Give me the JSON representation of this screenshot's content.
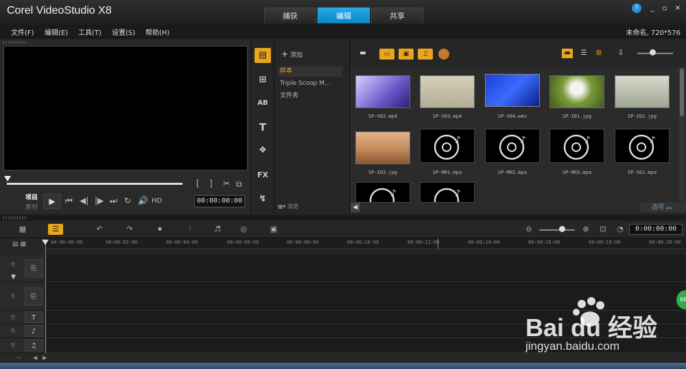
{
  "app": {
    "title": "Corel VideoStudio X8",
    "mode_tabs": [
      "捕获",
      "编辑",
      "共享"
    ],
    "active_tab": "编辑",
    "help_icon": "?",
    "win_buttons": [
      "_",
      "▫",
      "✕"
    ]
  },
  "menu": {
    "items": [
      "文件(F)",
      "编辑(E)",
      "工具(T)",
      "设置(S)",
      "帮助(H)"
    ],
    "project_info": "未命名, 720*576"
  },
  "player": {
    "label_project": "项目",
    "label_clip": "素材",
    "timecode": "00:00:00:00",
    "hd_label": "HD",
    "bracket_in": "[",
    "bracket_out": "]"
  },
  "library": {
    "strip": [
      "media-icon",
      "instant-project-icon",
      "transition-icon",
      "title-icon",
      "graphic-icon",
      "filter-icon",
      "path-icon"
    ],
    "strip_labels": {
      "ab": "AB",
      "title": "T",
      "fx": "FX"
    },
    "add_label": "添加",
    "folders": [
      "样本",
      "Triple Scoop M...",
      "文件夹"
    ],
    "active_folder": "样本",
    "browse_label": "浏览"
  },
  "media": {
    "items": [
      {
        "label": "SP-V02.mp4",
        "kind": "video",
        "color": "#6a58c8"
      },
      {
        "label": "SP-V03.mp4",
        "kind": "video",
        "color": "#c9c2ac"
      },
      {
        "label": "SP-V04.wmv",
        "kind": "video",
        "color": "#1b3fd0"
      },
      {
        "label": "SP-I01.jpg",
        "kind": "image",
        "color": "#7c9a3a"
      },
      {
        "label": "SP-I02.jpg",
        "kind": "image",
        "color": "#b9bfae"
      },
      {
        "label": "SP-I03.jpg",
        "kind": "image",
        "color": "#c08a5a"
      },
      {
        "label": "SP-M01.mpa",
        "kind": "audio"
      },
      {
        "label": "SP-M02.mpa",
        "kind": "audio"
      },
      {
        "label": "SP-M03.mpa",
        "kind": "audio"
      },
      {
        "label": "SP-S01.mpa",
        "kind": "audio"
      },
      {
        "label": "",
        "kind": "audio"
      },
      {
        "label": "",
        "kind": "audio"
      }
    ],
    "options_label": "选项"
  },
  "timeline": {
    "timecode": "0:00:00:00",
    "ruler": [
      "00:00:00:00",
      "00:00:02:00",
      "00:00:04:00",
      "00:00:06:00",
      "00:00:08:00",
      "00:00:10:00",
      "00:00:12:00",
      "00:00:14:00",
      "00:00:16:00",
      "00:00:18:00",
      "00:00:20:00"
    ],
    "tracks": [
      "video-track",
      "overlay-track",
      "title-track",
      "voice-track",
      "music-track"
    ],
    "track_glyphs": [
      "⎘",
      "⎘",
      "T",
      "♪",
      "♫"
    ]
  },
  "watermark": {
    "text": "Bai du 经验",
    "url": "jingyan.baidu.com"
  },
  "side_badge": "66",
  "colors": {
    "accent": "#e9a51c",
    "tab_active": "#0a84c8"
  }
}
